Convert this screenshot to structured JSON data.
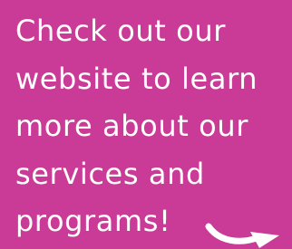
{
  "message": {
    "lines": [
      "Check out our",
      "website to learn",
      "more about our",
      "services and",
      "programs!"
    ]
  },
  "colors": {
    "background": "#CA3A97",
    "text": "#FFFFFF",
    "arrow": "#FFFFFF"
  },
  "icons": {
    "arrow": "curved-arrow-right-icon"
  }
}
